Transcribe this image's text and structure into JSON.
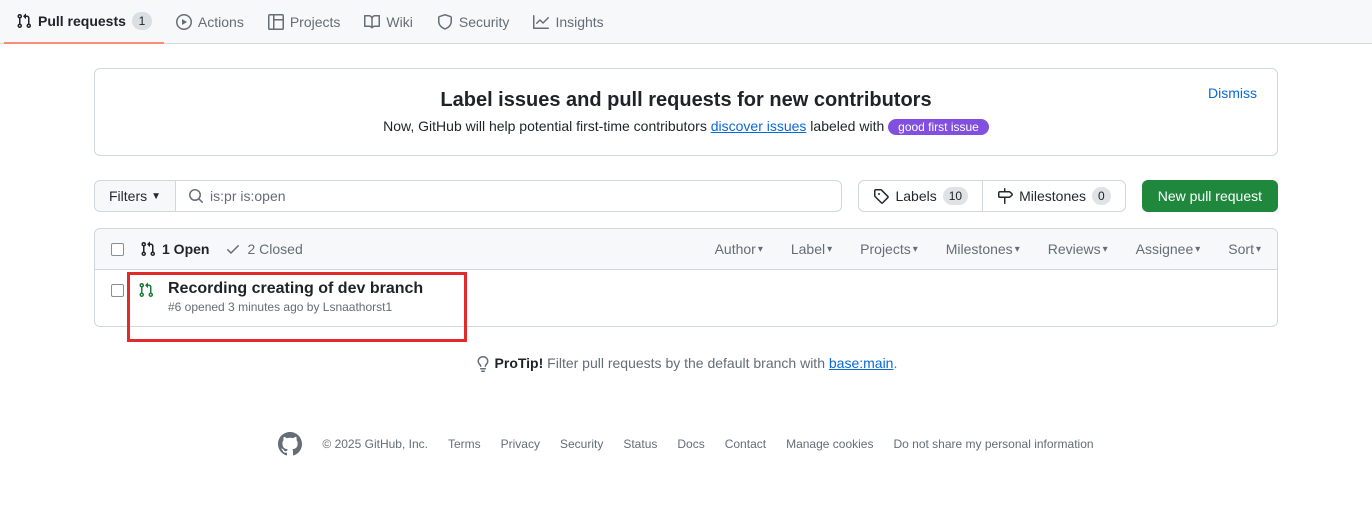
{
  "nav": {
    "pull_requests": {
      "label": "Pull requests",
      "count": "1"
    },
    "actions": {
      "label": "Actions"
    },
    "projects": {
      "label": "Projects"
    },
    "wiki": {
      "label": "Wiki"
    },
    "security": {
      "label": "Security"
    },
    "insights": {
      "label": "Insights"
    }
  },
  "banner": {
    "title": "Label issues and pull requests for new contributors",
    "text_pre": "Now, GitHub will help potential first-time contributors ",
    "link": "discover issues",
    "text_post": " labeled with ",
    "pill": "good first issue",
    "dismiss": "Dismiss"
  },
  "toolbar": {
    "filters": "Filters",
    "search_value": "is:pr is:open",
    "labels": {
      "label": "Labels",
      "count": "10"
    },
    "milestones": {
      "label": "Milestones",
      "count": "0"
    },
    "new_pr": "New pull request"
  },
  "list_header": {
    "open": "1 Open",
    "closed": "2 Closed",
    "filters": [
      "Author",
      "Label",
      "Projects",
      "Milestones",
      "Reviews",
      "Assignee",
      "Sort"
    ]
  },
  "pr": {
    "title": "Recording creating of dev branch",
    "meta": "#6 opened 3 minutes ago by Lsnaathorst1"
  },
  "protip": {
    "label": "ProTip!",
    "text": " Filter pull requests by the default branch with ",
    "link": "base:main",
    "dot": "."
  },
  "footer": {
    "copyright": "© 2025 GitHub, Inc.",
    "links": [
      "Terms",
      "Privacy",
      "Security",
      "Status",
      "Docs",
      "Contact",
      "Manage cookies",
      "Do not share my personal information"
    ]
  }
}
